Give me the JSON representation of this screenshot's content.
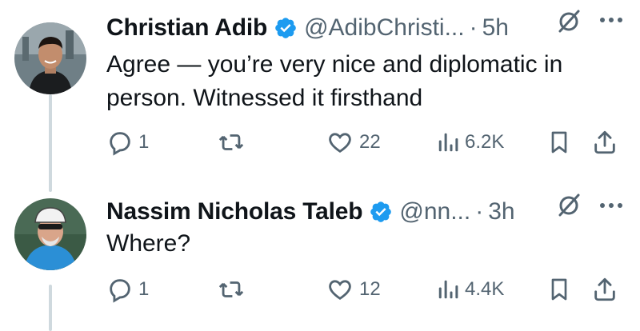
{
  "tweets": [
    {
      "name": "Christian Adib",
      "handle": "@AdibChristi...",
      "separator": "·",
      "time": "5h",
      "text_lines": [
        "Agree — you’re very nice and diplomatic in",
        "person. Witnessed it firsthand"
      ],
      "replies": "1",
      "likes": "22",
      "views": "6.2K"
    },
    {
      "name": "Nassim Nicholas Taleb",
      "handle": "@nn...",
      "separator": "·",
      "time": "3h",
      "text_lines": [
        "Where?"
      ],
      "replies": "1",
      "likes": "12",
      "views": "4.4K"
    }
  ],
  "icons": {
    "verified": "verified-badge-icon",
    "grok": "grok-icon",
    "more": "more-icon",
    "reply": "reply-icon",
    "retweet": "retweet-icon",
    "like": "like-icon",
    "views": "views-icon",
    "bookmark": "bookmark-icon",
    "share": "share-icon"
  },
  "colors": {
    "text": "#0f1419",
    "secondary": "#536471",
    "verified": "#1d9bf0",
    "thread_line": "#cfd9de"
  }
}
